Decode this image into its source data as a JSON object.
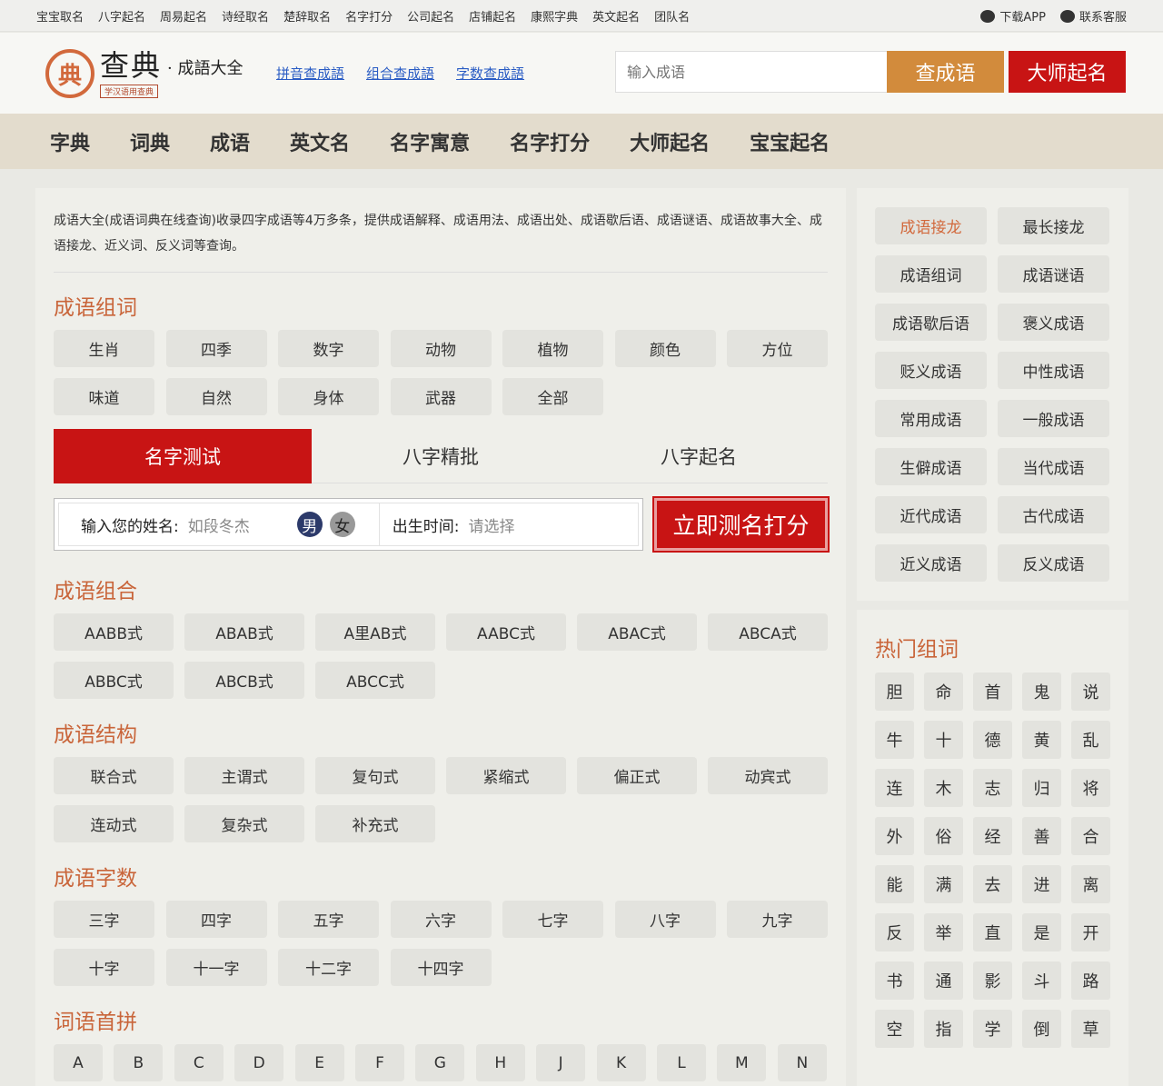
{
  "topbar": {
    "links": [
      "宝宝取名",
      "八字起名",
      "周易起名",
      "诗经取名",
      "楚辞取名",
      "名字打分",
      "公司起名",
      "店铺起名",
      "康熙字典",
      "英文起名",
      "团队名"
    ],
    "download_app": "下载APP",
    "contact": "联系客服"
  },
  "header": {
    "logo_seal": "典",
    "brand": "查典",
    "brand_small": "学汉语用查典",
    "sub_title": "· 成語大全",
    "links": [
      "拼音查成語",
      "组合查成語",
      "字数查成語"
    ],
    "search_placeholder": "输入成语",
    "search_button": "查成语",
    "master_button": "大师起名"
  },
  "nav": [
    "字典",
    "词典",
    "成语",
    "英文名",
    "名字寓意",
    "名字打分",
    "大师起名",
    "宝宝起名"
  ],
  "main": {
    "intro": "成语大全(成语词典在线查询)收录四字成语等4万多条，提供成语解释、成语用法、成语出处、成语歇后语、成语谜语、成语故事大全、成语接龙、近义词、反义词等查询。",
    "groups_title": "成语组词",
    "groups": [
      "生肖",
      "四季",
      "数字",
      "动物",
      "植物",
      "颜色",
      "方位",
      "味道",
      "自然",
      "身体",
      "武器",
      "全部"
    ],
    "tabs": [
      "名字测试",
      "八字精批",
      "八字起名"
    ],
    "test": {
      "name_label": "输入您的姓名:",
      "name_placeholder": "如段冬杰",
      "male": "男",
      "female": "女",
      "birth_label": "出生时间:",
      "birth_placeholder": "请选择",
      "submit": "立即测名打分"
    },
    "combo_title": "成语组合",
    "combos": [
      "AABB式",
      "ABAB式",
      "A里AB式",
      "AABC式",
      "ABAC式",
      "ABCA式",
      "ABBC式",
      "ABCB式",
      "ABCC式"
    ],
    "struct_title": "成语结构",
    "structs": [
      "联合式",
      "主谓式",
      "复句式",
      "紧缩式",
      "偏正式",
      "动宾式",
      "连动式",
      "复杂式",
      "补充式"
    ],
    "count_title": "成语字数",
    "counts": [
      "三字",
      "四字",
      "五字",
      "六字",
      "七字",
      "八字",
      "九字",
      "十字",
      "十一字",
      "十二字",
      "十四字"
    ],
    "pinyin_title": "词语首拼",
    "letters": [
      "A",
      "B",
      "C",
      "D",
      "E",
      "F",
      "G",
      "H",
      "J",
      "K",
      "L",
      "M",
      "N"
    ]
  },
  "side": {
    "links": [
      "成语接龙",
      "最长接龙",
      "成语组词",
      "成语谜语",
      "成语歇后语",
      "褒义成语",
      "贬义成语",
      "中性成语",
      "常用成语",
      "一般成语",
      "生僻成语",
      "当代成语",
      "近代成语",
      "古代成语",
      "近义成语",
      "反义成语"
    ],
    "hot_title": "热门组词",
    "hot": [
      "胆",
      "命",
      "首",
      "鬼",
      "说",
      "牛",
      "十",
      "德",
      "黄",
      "乱",
      "连",
      "木",
      "志",
      "归",
      "将",
      "外",
      "俗",
      "经",
      "善",
      "合",
      "能",
      "满",
      "去",
      "进",
      "离",
      "反",
      "举",
      "直",
      "是",
      "开",
      "书",
      "通",
      "影",
      "斗",
      "路",
      "空",
      "指",
      "学",
      "倒",
      "草"
    ]
  },
  "colors": {
    "accent": "#c81414",
    "orange": "#d28b3c",
    "title": "#c9653a",
    "link": "#2a5cc4"
  }
}
